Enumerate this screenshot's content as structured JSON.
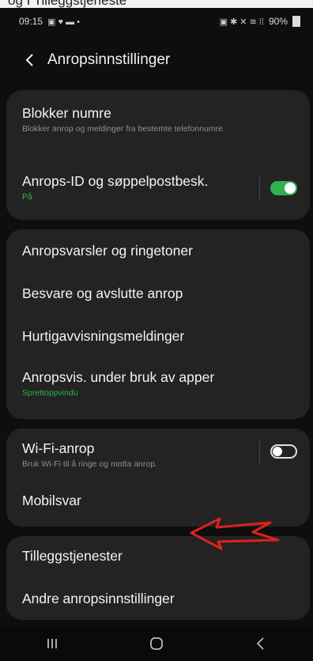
{
  "top_crop_text": "og I Tilleggstjeneste",
  "status_bar": {
    "time": "09:15",
    "left_icons": "▣ ♥ ▬ •",
    "right_icons": "▣ ✱ ✕ ≋ ⁞⁞",
    "battery": "90%"
  },
  "header": {
    "title": "Anropsinnstillinger"
  },
  "group1": {
    "block": {
      "title": "Blokker numre",
      "subtitle": "Blokker anrop og meldinger fra bestemte telefonnumre."
    },
    "caller_id": {
      "title": "Anrops-ID og søppelpostbesk.",
      "status": "På",
      "toggle_on": true
    }
  },
  "group2": {
    "items": [
      {
        "title": "Anropsvarsler og ringetoner"
      },
      {
        "title": "Besvare og avslutte anrop"
      },
      {
        "title": "Hurtigavvisningsmeldinger"
      },
      {
        "title": "Anropsvis. under bruk av apper",
        "status": "Sprettoppvindu"
      }
    ]
  },
  "group3": {
    "wifi_call": {
      "title": "Wi-Fi-anrop",
      "subtitle": "Bruk Wi-Fi til å ringe og motta anrop.",
      "toggle_on": false
    },
    "voicemail": {
      "title": "Mobilsvar"
    }
  },
  "group4": {
    "extra_services": {
      "title": "Tilleggstjenester"
    },
    "other_settings": {
      "title": "Andre anropsinnstillinger"
    }
  },
  "colors": {
    "accent_green": "#2fb14f",
    "annotation_red": "#e0201c",
    "card_bg": "#232323"
  },
  "icons": {
    "back": "back-arrow-icon",
    "nav_recents": "recents-icon",
    "nav_home": "home-icon",
    "nav_back": "back-icon",
    "annotation": "red-arrow-annotation"
  }
}
